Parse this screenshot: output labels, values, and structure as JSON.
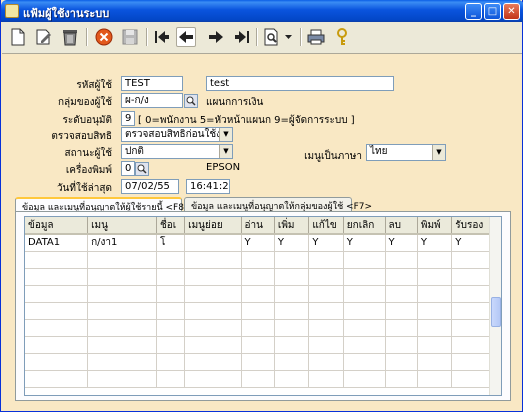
{
  "window": {
    "title": "แฟ้มผู้ใช้งานระบบ"
  },
  "toolbar": {
    "buttons": [
      "new-icon",
      "edit-icon",
      "delete-icon",
      "cancel-icon",
      "save-icon",
      "first-icon",
      "previous-icon",
      "next-icon",
      "last-icon",
      "search-icon",
      "dropdown-icon",
      "print-icon",
      "key-icon"
    ]
  },
  "form": {
    "user_id": {
      "label": "รหัสผู้ใช้",
      "value": "TEST",
      "name": "test"
    },
    "user_group": {
      "label": "กลุ่มของผู้ใช้",
      "value": "ผ-ก/ง",
      "description": "แผนกการเงิน"
    },
    "approval_level": {
      "label": "ระดับอนุมัติ",
      "value": "9",
      "hint": "[ 0=พนักงาน  5=หัวหน้าแผนก  9=ผู้จัดการระบบ ]"
    },
    "check_rights": {
      "label": "ตรวจสอบสิทธิ",
      "value": "ตรวจสอบสิทธิก่อนใช้งาน"
    },
    "user_status": {
      "label": "สถานะผู้ใช้",
      "value": "ปกติ"
    },
    "menu_language": {
      "label": "เมนูเป็นภาษา",
      "value": "ไทย"
    },
    "printer": {
      "label": "เครื่องพิมพ์",
      "value": "0",
      "name": "EPSON"
    },
    "last_used": {
      "label": "วันที่ใช้ล่าสุด",
      "date": "07/02/55",
      "time": "16:41:27"
    }
  },
  "tabs": [
    {
      "label": "ข้อมูล และเมนูที่อนุญาตให้ผู้ใช้รายนี้  <F8>",
      "active": true
    },
    {
      "label": "ข้อมูล และเมนูที่อนุญาตให้กลุ่มของผู้ใช้  <F7>",
      "active": false
    }
  ],
  "grid": {
    "columns": [
      "ข้อมูล",
      "เมนู",
      "ชื่อเ",
      "เมนูย่อย",
      "อ่าน",
      "เพิ่ม",
      "แก้ไข",
      "ยกเลิก",
      "ลบ",
      "พิมพ์",
      "รับรอง"
    ],
    "rows": [
      [
        "DATA1",
        "ก/งา1",
        "โ",
        "",
        "Y",
        "Y",
        "Y",
        "Y",
        "Y",
        "Y",
        "Y"
      ]
    ],
    "empty_rows": 8
  }
}
